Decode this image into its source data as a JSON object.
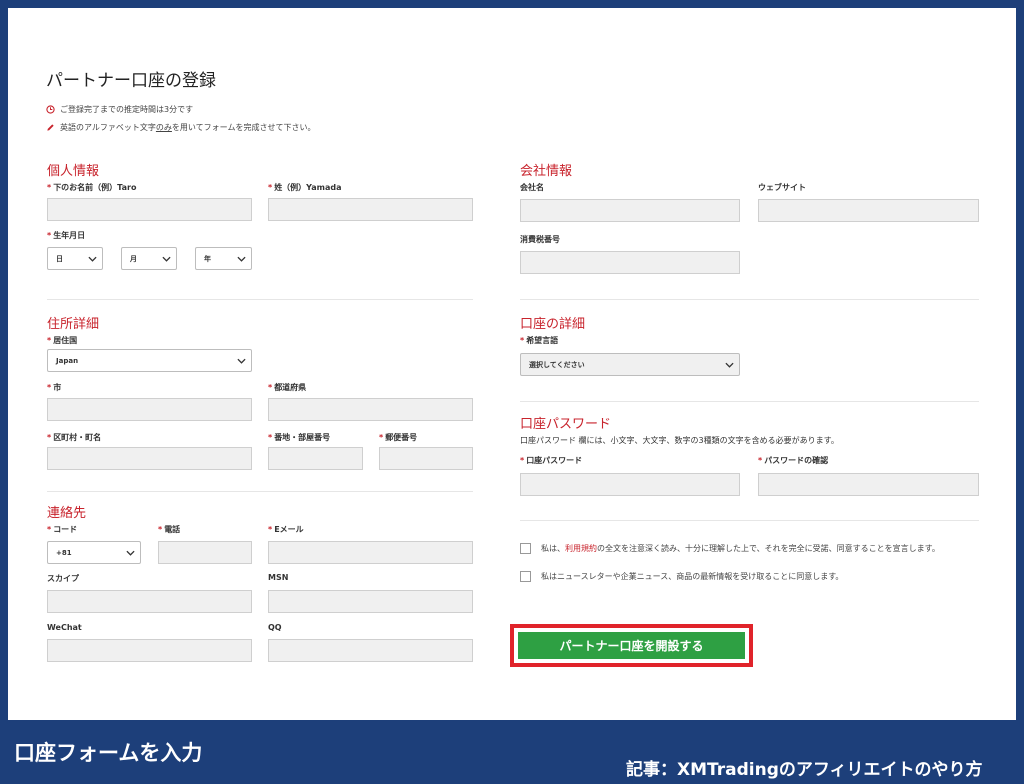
{
  "form_title": "パートナー口座の登録",
  "notes": {
    "time": "ご登録完了までの推定時間は3分です",
    "alpha_prefix": "英語のアルファベット文字",
    "alpha_underline": "のみ",
    "alpha_suffix": "を用いてフォームを完成させて下さい。"
  },
  "required_mark": "*",
  "personal": {
    "heading": "個人情報",
    "first_name_label": "下のお名前（例）Taro",
    "last_name_label": "姓（例）Yamada",
    "dob_label": "生年月日",
    "day": "日",
    "month": "月",
    "year": "年"
  },
  "address": {
    "heading": "住所詳細",
    "country_label": "居住国",
    "country_value": "Japan",
    "city_label": "市",
    "prefecture_label": "都道府県",
    "ward_label": "区町村・町名",
    "street_label": "番地・部屋番号",
    "zip_label": "郵便番号"
  },
  "contact": {
    "heading": "連絡先",
    "code_label": "コード",
    "code_value": "+81",
    "phone_label": "電話",
    "email_label": "Eメール",
    "skype_label": "スカイプ",
    "msn_label": "MSN",
    "wechat_label": "WeChat",
    "qq_label": "QQ"
  },
  "company": {
    "heading": "会社情報",
    "name_label": "会社名",
    "website_label": "ウェブサイト",
    "tax_label": "消費税番号"
  },
  "account": {
    "heading": "口座の詳細",
    "lang_label": "希望言語",
    "lang_value": "選択してください"
  },
  "password": {
    "heading": "口座パスワード",
    "desc": "口座パスワード 欄には、小文字、大文字、数字の3種類の文字を含める必要があります。",
    "pw_label": "口座パスワード",
    "confirm_label": "パスワードの確認"
  },
  "agreements": {
    "terms_pre": "私は、",
    "terms_link": "利用規約",
    "terms_post": "の全文を注意深く読み、十分に理解した上で、それを完全に受諾、同意することを宣言します。",
    "newsletter": "私はニュースレターや企業ニュース、商品の最新情報を受け取ることに同意します。"
  },
  "submit_label": "パートナー口座を開設する",
  "footer": {
    "left": "口座フォームを入力",
    "right": "記事：XMTradingのアフィリエイトのやり方"
  }
}
